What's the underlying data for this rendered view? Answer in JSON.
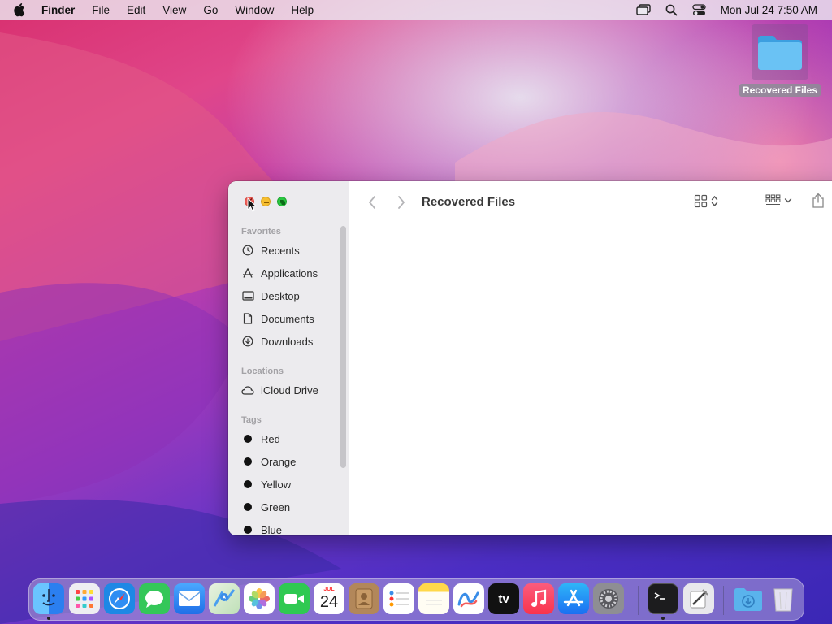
{
  "menubar": {
    "app_name": "Finder",
    "menus": [
      "File",
      "Edit",
      "View",
      "Go",
      "Window",
      "Help"
    ],
    "clock": "Mon Jul 24  7:50 AM",
    "status_icons": [
      "screen-mirroring-icon",
      "search-icon",
      "control-center-icon"
    ]
  },
  "desktop": {
    "folder_label": "Recovered Files"
  },
  "finder": {
    "title": "Recovered Files",
    "sidebar": {
      "favorites_header": "Favorites",
      "favorites": [
        {
          "label": "Recents",
          "icon": "clock-icon"
        },
        {
          "label": "Applications",
          "icon": "applications-icon"
        },
        {
          "label": "Desktop",
          "icon": "desktop-icon"
        },
        {
          "label": "Documents",
          "icon": "document-icon"
        },
        {
          "label": "Downloads",
          "icon": "download-icon"
        }
      ],
      "locations_header": "Locations",
      "locations": [
        {
          "label": "iCloud Drive",
          "icon": "cloud-icon"
        }
      ],
      "tags_header": "Tags",
      "tags": [
        {
          "label": "Red"
        },
        {
          "label": "Orange"
        },
        {
          "label": "Yellow"
        },
        {
          "label": "Green"
        },
        {
          "label": "Blue"
        }
      ]
    }
  },
  "dock": {
    "calendar_month": "JUL",
    "calendar_day": "24",
    "apps": [
      "Finder",
      "Launchpad",
      "Safari",
      "Messages",
      "Mail",
      "Maps",
      "Photos",
      "FaceTime",
      "Calendar",
      "Contacts",
      "Reminders",
      "Notes",
      "Freeform",
      "TV",
      "Music",
      "App Store",
      "System Settings",
      "Terminal",
      "Script Editor",
      "Downloads",
      "Trash"
    ],
    "tv_label": "tv",
    "colors": {
      "finder": "#2f8ff0",
      "safari": "#1e88e5",
      "messages": "#34c759",
      "mail": "#2e7cf6",
      "facetime": "#2fc952",
      "music": "#fb3b55",
      "appstore": "#1f8ef1",
      "settings": "#8e8e93",
      "terminal": "#1c1c1e",
      "contacts": "#b2875a"
    }
  }
}
